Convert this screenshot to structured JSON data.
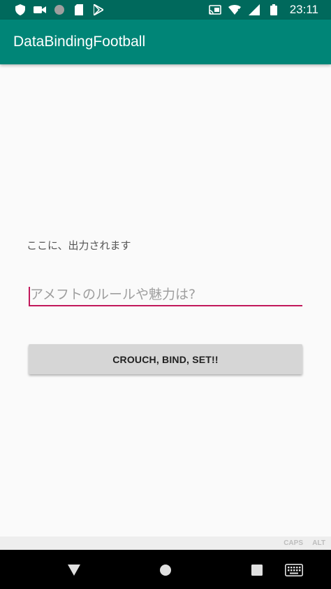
{
  "status_bar": {
    "time": "23:11",
    "icons_left": [
      "shield-icon",
      "video-camera-icon",
      "circle-icon",
      "sd-card-icon",
      "play-store-icon"
    ],
    "icons_right": [
      "cast-icon",
      "wifi-icon",
      "signal-icon",
      "battery-icon"
    ]
  },
  "app_bar": {
    "title": "DataBindingFootball"
  },
  "main": {
    "output_text": "ここに、出力されます",
    "input": {
      "value": "",
      "placeholder": "アメフトのルールや魅力は?"
    },
    "button_label": "CROUCH, BIND, SET!!"
  },
  "keyboard_hint": {
    "caps": "CAPS",
    "alt": "ALT"
  },
  "nav_bar": {
    "buttons": [
      "back-icon",
      "home-icon",
      "recents-icon",
      "keyboard-icon"
    ]
  },
  "colors": {
    "status_bar": "#00695c",
    "app_bar": "#008577",
    "accent": "#c2185b",
    "button": "#d6d6d6"
  }
}
